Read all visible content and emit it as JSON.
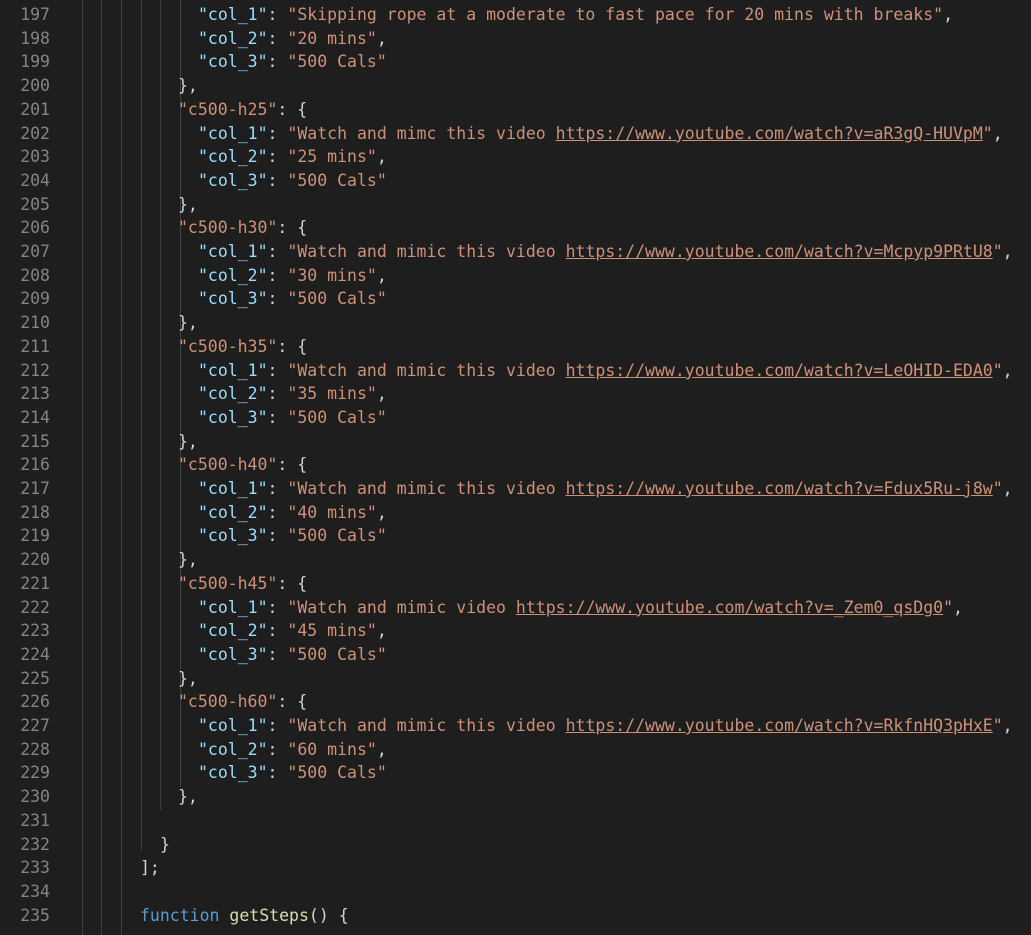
{
  "editor": {
    "lines": [
      {
        "n": "197",
        "indent": 3,
        "tokens": [
          {
            "t": "k",
            "v": "\"col_1\""
          },
          {
            "t": "p",
            "v": ": "
          },
          {
            "t": "s",
            "v": "\"Skipping rope at a moderate to fast pace for 20 mins with breaks\""
          },
          {
            "t": "p",
            "v": ","
          }
        ]
      },
      {
        "n": "198",
        "indent": 3,
        "tokens": [
          {
            "t": "k",
            "v": "\"col_2\""
          },
          {
            "t": "p",
            "v": ": "
          },
          {
            "t": "s",
            "v": "\"20 mins\""
          },
          {
            "t": "p",
            "v": ","
          }
        ]
      },
      {
        "n": "199",
        "indent": 3,
        "tokens": [
          {
            "t": "k",
            "v": "\"col_3\""
          },
          {
            "t": "p",
            "v": ": "
          },
          {
            "t": "s",
            "v": "\"500 Cals\""
          }
        ]
      },
      {
        "n": "200",
        "indent": 2,
        "tokens": [
          {
            "t": "p",
            "v": "},"
          }
        ]
      },
      {
        "n": "201",
        "indent": 2,
        "tokens": [
          {
            "t": "s",
            "v": "\"c500-h25\""
          },
          {
            "t": "p",
            "v": ": {"
          }
        ]
      },
      {
        "n": "202",
        "indent": 3,
        "tokens": [
          {
            "t": "k",
            "v": "\"col_1\""
          },
          {
            "t": "p",
            "v": ": "
          },
          {
            "t": "s",
            "v": "\"Watch and mimc this video "
          },
          {
            "t": "u",
            "v": "https://www.youtube.com/watch?v=aR3gQ-HUVpM"
          },
          {
            "t": "s",
            "v": "\""
          },
          {
            "t": "p",
            "v": ","
          }
        ]
      },
      {
        "n": "203",
        "indent": 3,
        "tokens": [
          {
            "t": "k",
            "v": "\"col_2\""
          },
          {
            "t": "p",
            "v": ": "
          },
          {
            "t": "s",
            "v": "\"25 mins\""
          },
          {
            "t": "p",
            "v": ","
          }
        ]
      },
      {
        "n": "204",
        "indent": 3,
        "tokens": [
          {
            "t": "k",
            "v": "\"col_3\""
          },
          {
            "t": "p",
            "v": ": "
          },
          {
            "t": "s",
            "v": "\"500 Cals\""
          }
        ]
      },
      {
        "n": "205",
        "indent": 2,
        "tokens": [
          {
            "t": "p",
            "v": "},"
          }
        ]
      },
      {
        "n": "206",
        "indent": 2,
        "tokens": [
          {
            "t": "s",
            "v": "\"c500-h30\""
          },
          {
            "t": "p",
            "v": ": {"
          }
        ]
      },
      {
        "n": "207",
        "indent": 3,
        "tokens": [
          {
            "t": "k",
            "v": "\"col_1\""
          },
          {
            "t": "p",
            "v": ": "
          },
          {
            "t": "s",
            "v": "\"Watch and mimic this video "
          },
          {
            "t": "u",
            "v": "https://www.youtube.com/watch?v=Mcpyp9PRtU8"
          },
          {
            "t": "s",
            "v": "\""
          },
          {
            "t": "p",
            "v": ","
          }
        ]
      },
      {
        "n": "208",
        "indent": 3,
        "tokens": [
          {
            "t": "k",
            "v": "\"col_2\""
          },
          {
            "t": "p",
            "v": ": "
          },
          {
            "t": "s",
            "v": "\"30 mins\""
          },
          {
            "t": "p",
            "v": ","
          }
        ]
      },
      {
        "n": "209",
        "indent": 3,
        "tokens": [
          {
            "t": "k",
            "v": "\"col_3\""
          },
          {
            "t": "p",
            "v": ": "
          },
          {
            "t": "s",
            "v": "\"500 Cals\""
          }
        ]
      },
      {
        "n": "210",
        "indent": 2,
        "tokens": [
          {
            "t": "p",
            "v": "},"
          }
        ]
      },
      {
        "n": "211",
        "indent": 2,
        "tokens": [
          {
            "t": "s",
            "v": "\"c500-h35\""
          },
          {
            "t": "p",
            "v": ": {"
          }
        ]
      },
      {
        "n": "212",
        "indent": 3,
        "tokens": [
          {
            "t": "k",
            "v": "\"col_1\""
          },
          {
            "t": "p",
            "v": ": "
          },
          {
            "t": "s",
            "v": "\"Watch and mimic this video "
          },
          {
            "t": "u",
            "v": "https://www.youtube.com/watch?v=LeOHID-EDA0"
          },
          {
            "t": "s",
            "v": "\""
          },
          {
            "t": "p",
            "v": ","
          }
        ]
      },
      {
        "n": "213",
        "indent": 3,
        "tokens": [
          {
            "t": "k",
            "v": "\"col_2\""
          },
          {
            "t": "p",
            "v": ": "
          },
          {
            "t": "s",
            "v": "\"35 mins\""
          },
          {
            "t": "p",
            "v": ","
          }
        ]
      },
      {
        "n": "214",
        "indent": 3,
        "tokens": [
          {
            "t": "k",
            "v": "\"col_3\""
          },
          {
            "t": "p",
            "v": ": "
          },
          {
            "t": "s",
            "v": "\"500 Cals\""
          }
        ]
      },
      {
        "n": "215",
        "indent": 2,
        "tokens": [
          {
            "t": "p",
            "v": "},"
          }
        ]
      },
      {
        "n": "216",
        "indent": 2,
        "tokens": [
          {
            "t": "s",
            "v": "\"c500-h40\""
          },
          {
            "t": "p",
            "v": ": {"
          }
        ]
      },
      {
        "n": "217",
        "indent": 3,
        "tokens": [
          {
            "t": "k",
            "v": "\"col_1\""
          },
          {
            "t": "p",
            "v": ": "
          },
          {
            "t": "s",
            "v": "\"Watch and mimic this video "
          },
          {
            "t": "u",
            "v": "https://www.youtube.com/watch?v=Fdux5Ru-j8w"
          },
          {
            "t": "s",
            "v": "\""
          },
          {
            "t": "p",
            "v": ","
          }
        ]
      },
      {
        "n": "218",
        "indent": 3,
        "tokens": [
          {
            "t": "k",
            "v": "\"col_2\""
          },
          {
            "t": "p",
            "v": ": "
          },
          {
            "t": "s",
            "v": "\"40 mins\""
          },
          {
            "t": "p",
            "v": ","
          }
        ]
      },
      {
        "n": "219",
        "indent": 3,
        "tokens": [
          {
            "t": "k",
            "v": "\"col_3\""
          },
          {
            "t": "p",
            "v": ": "
          },
          {
            "t": "s",
            "v": "\"500 Cals\""
          }
        ]
      },
      {
        "n": "220",
        "indent": 2,
        "tokens": [
          {
            "t": "p",
            "v": "},"
          }
        ]
      },
      {
        "n": "221",
        "indent": 2,
        "tokens": [
          {
            "t": "s",
            "v": "\"c500-h45\""
          },
          {
            "t": "p",
            "v": ": {"
          }
        ]
      },
      {
        "n": "222",
        "indent": 3,
        "tokens": [
          {
            "t": "k",
            "v": "\"col_1\""
          },
          {
            "t": "p",
            "v": ": "
          },
          {
            "t": "s",
            "v": "\"Watch and mimic video "
          },
          {
            "t": "u",
            "v": "https://www.youtube.com/watch?v=_Zem0_qsDg0"
          },
          {
            "t": "s",
            "v": "\""
          },
          {
            "t": "p",
            "v": ","
          }
        ]
      },
      {
        "n": "223",
        "indent": 3,
        "tokens": [
          {
            "t": "k",
            "v": "\"col_2\""
          },
          {
            "t": "p",
            "v": ": "
          },
          {
            "t": "s",
            "v": "\"45 mins\""
          },
          {
            "t": "p",
            "v": ","
          }
        ]
      },
      {
        "n": "224",
        "indent": 3,
        "tokens": [
          {
            "t": "k",
            "v": "\"col_3\""
          },
          {
            "t": "p",
            "v": ": "
          },
          {
            "t": "s",
            "v": "\"500 Cals\""
          }
        ]
      },
      {
        "n": "225",
        "indent": 2,
        "tokens": [
          {
            "t": "p",
            "v": "},"
          }
        ]
      },
      {
        "n": "226",
        "indent": 2,
        "tokens": [
          {
            "t": "s",
            "v": "\"c500-h60\""
          },
          {
            "t": "p",
            "v": ": {"
          }
        ]
      },
      {
        "n": "227",
        "indent": 3,
        "tokens": [
          {
            "t": "k",
            "v": "\"col_1\""
          },
          {
            "t": "p",
            "v": ": "
          },
          {
            "t": "s",
            "v": "\"Watch and mimic this video "
          },
          {
            "t": "u",
            "v": "https://www.youtube.com/watch?v=RkfnHQ3pHxE"
          },
          {
            "t": "s",
            "v": "\""
          },
          {
            "t": "p",
            "v": ","
          }
        ]
      },
      {
        "n": "228",
        "indent": 3,
        "tokens": [
          {
            "t": "k",
            "v": "\"col_2\""
          },
          {
            "t": "p",
            "v": ": "
          },
          {
            "t": "s",
            "v": "\"60 mins\""
          },
          {
            "t": "p",
            "v": ","
          }
        ]
      },
      {
        "n": "229",
        "indent": 3,
        "tokens": [
          {
            "t": "k",
            "v": "\"col_3\""
          },
          {
            "t": "p",
            "v": ": "
          },
          {
            "t": "s",
            "v": "\"500 Cals\""
          }
        ]
      },
      {
        "n": "230",
        "indent": 2,
        "tokens": [
          {
            "t": "p",
            "v": "},"
          }
        ]
      },
      {
        "n": "231",
        "indent": 2,
        "tokens": []
      },
      {
        "n": "232",
        "indent": 1,
        "tokens": [
          {
            "t": "p",
            "v": "}"
          }
        ]
      },
      {
        "n": "233",
        "indent": 0,
        "tokens": [
          {
            "t": "p",
            "v": "];"
          }
        ]
      },
      {
        "n": "234",
        "indent": 0,
        "tokens": []
      },
      {
        "n": "235",
        "indent": 0,
        "tokens": [
          {
            "t": "kw",
            "v": "function"
          },
          {
            "t": "p",
            "v": " "
          },
          {
            "t": "fn",
            "v": "getSteps"
          },
          {
            "t": "p",
            "v": "() {"
          }
        ]
      }
    ]
  }
}
